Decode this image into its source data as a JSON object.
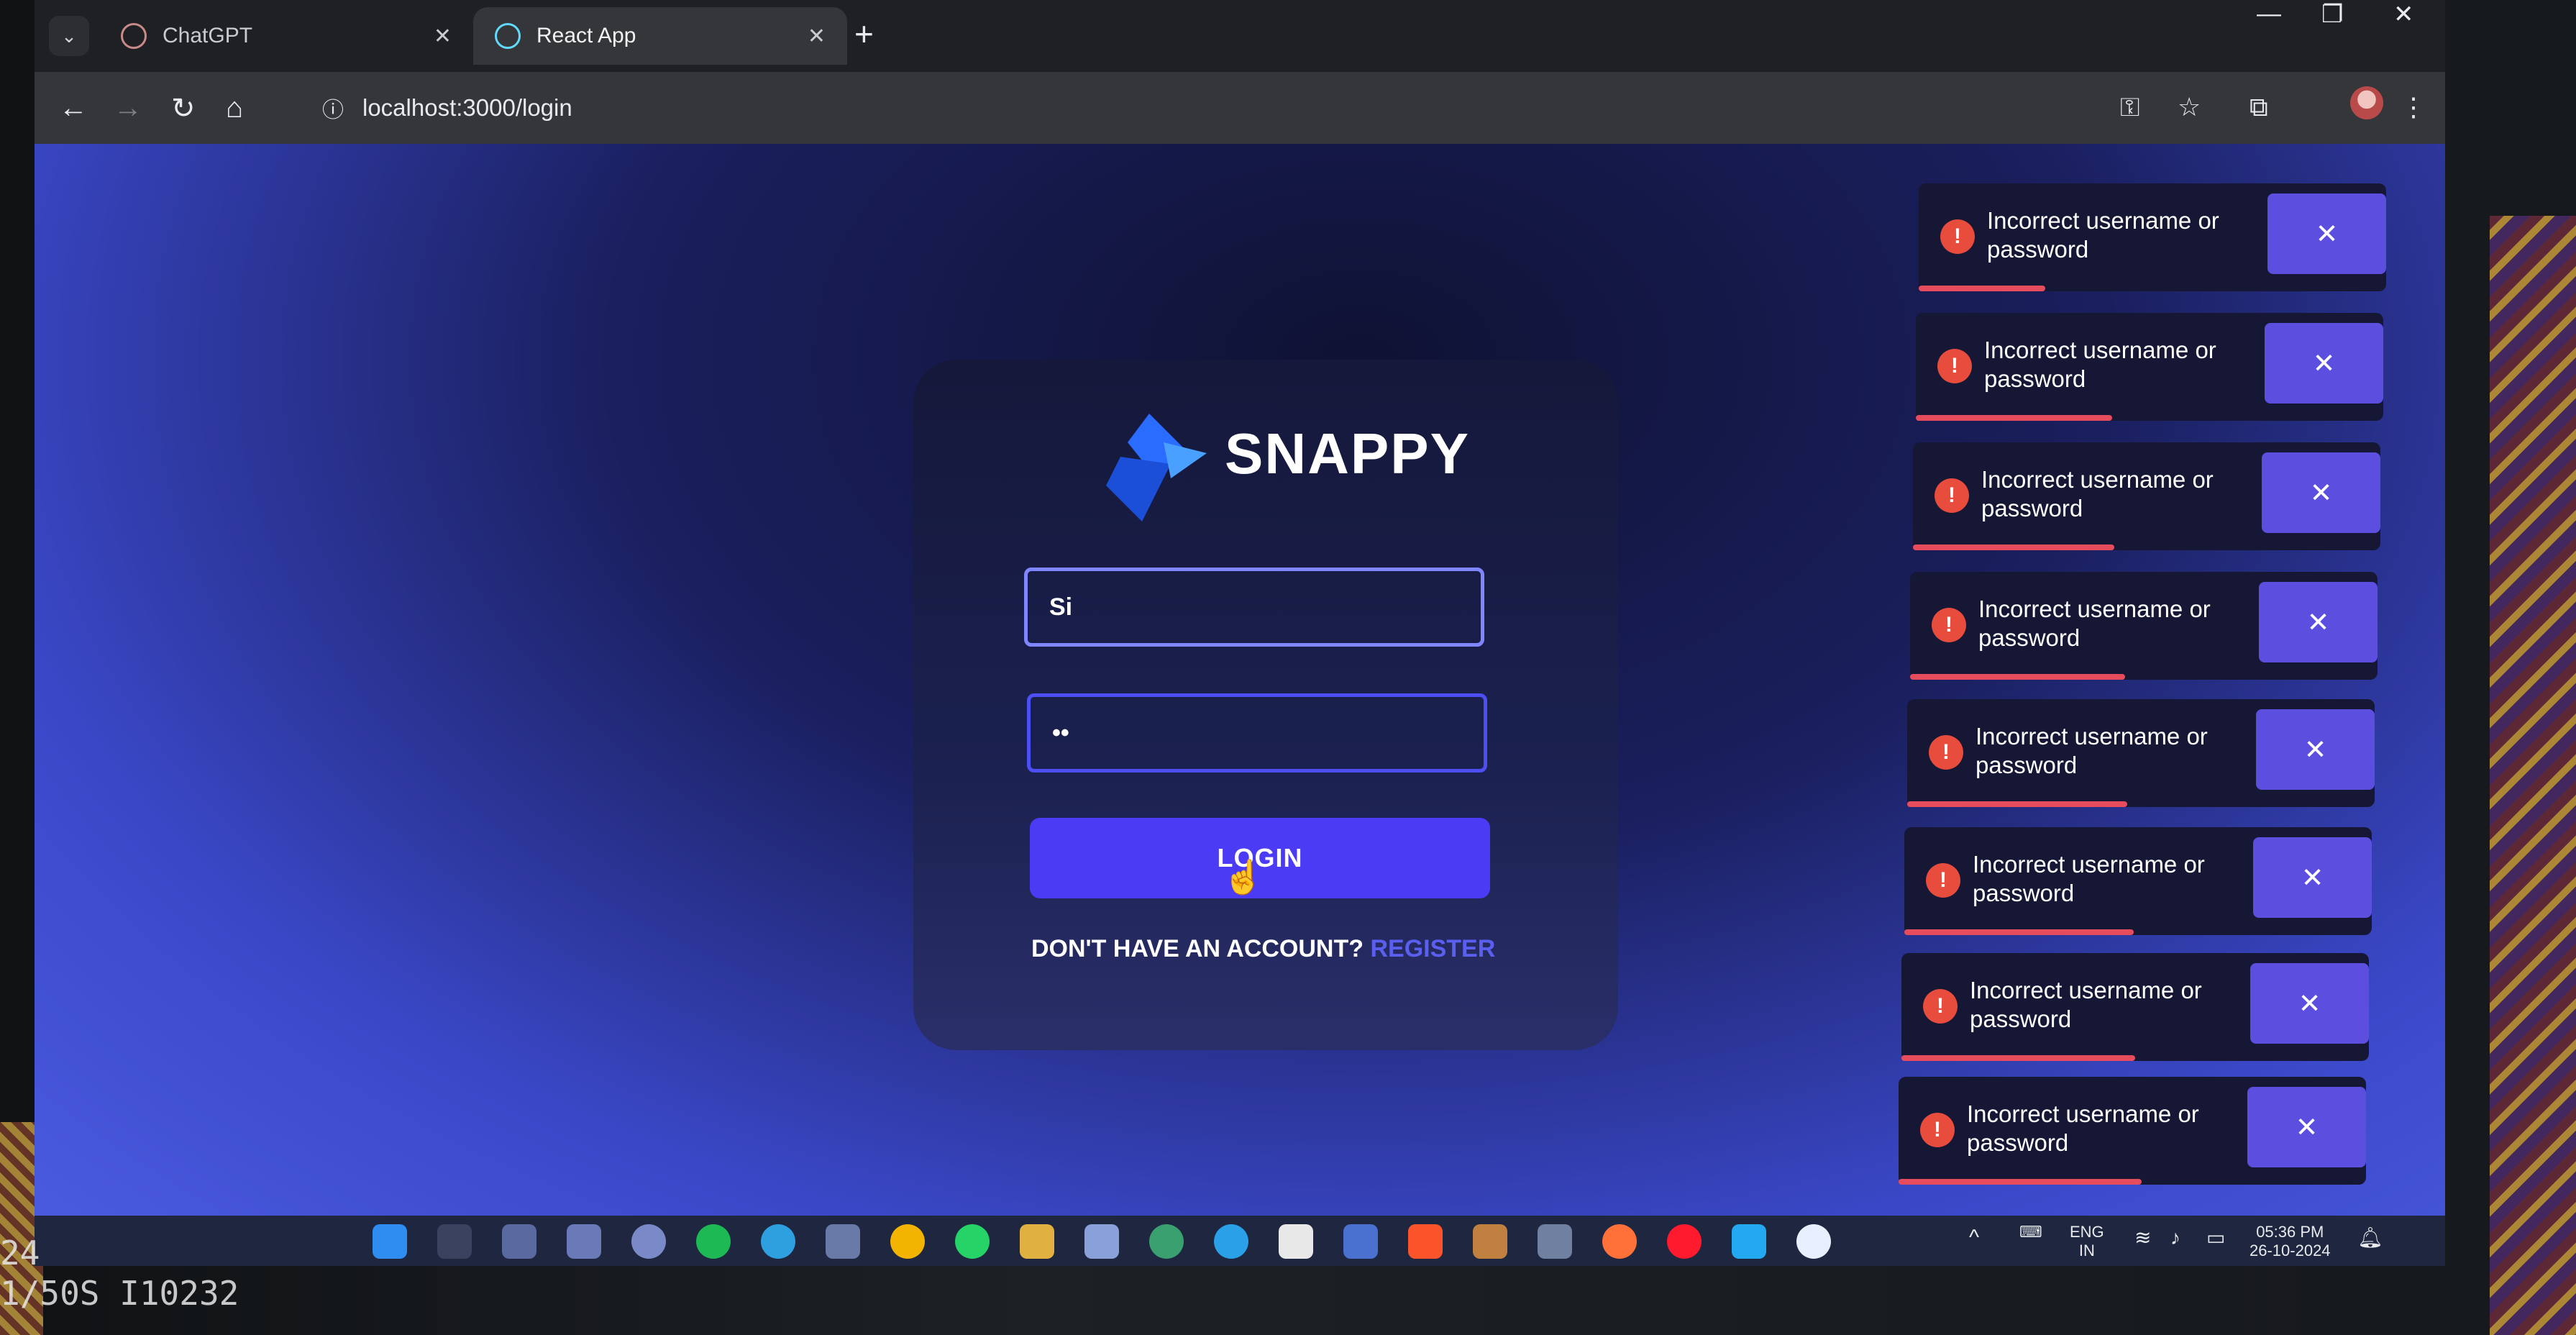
{
  "browser": {
    "tabs": [
      {
        "title": "ChatGPT",
        "active": false
      },
      {
        "title": "React App",
        "active": true
      }
    ],
    "new_tab": "+",
    "address": "localhost:3000/login"
  },
  "app": {
    "brand": "SNAPPY",
    "username_value": "Si",
    "password_value": "••",
    "login_label": "LOGIN",
    "no_account_text": "DON'T HAVE AN ACCOUNT?",
    "register_link": "REGISTER"
  },
  "toasts": [
    {
      "message": "Incorrect username or password",
      "close": "✕",
      "progress": 0.27
    },
    {
      "message": "Incorrect username or password",
      "close": "✕",
      "progress": 0.42
    },
    {
      "message": "Incorrect username or password",
      "close": "✕",
      "progress": 0.43
    },
    {
      "message": "Incorrect username or password",
      "close": "✕",
      "progress": 0.46
    },
    {
      "message": "Incorrect username or password",
      "close": "✕",
      "progress": 0.47
    },
    {
      "message": "Incorrect username or password",
      "close": "✕",
      "progress": 0.49
    },
    {
      "message": "Incorrect username or password",
      "close": "✕",
      "progress": 0.5
    },
    {
      "message": "Incorrect username or password",
      "close": "✕",
      "progress": 0.52
    }
  ],
  "taskbar": {
    "language": "ENG",
    "region": "IN",
    "time": "05:36 PM",
    "date": "26-10-2024"
  },
  "photo_overlay": {
    "line1": "24",
    "line2": "1/50S I10232"
  },
  "colors": {
    "accent": "#4b3bf5",
    "error": "#e74c3c",
    "link": "#5a5ff0"
  }
}
